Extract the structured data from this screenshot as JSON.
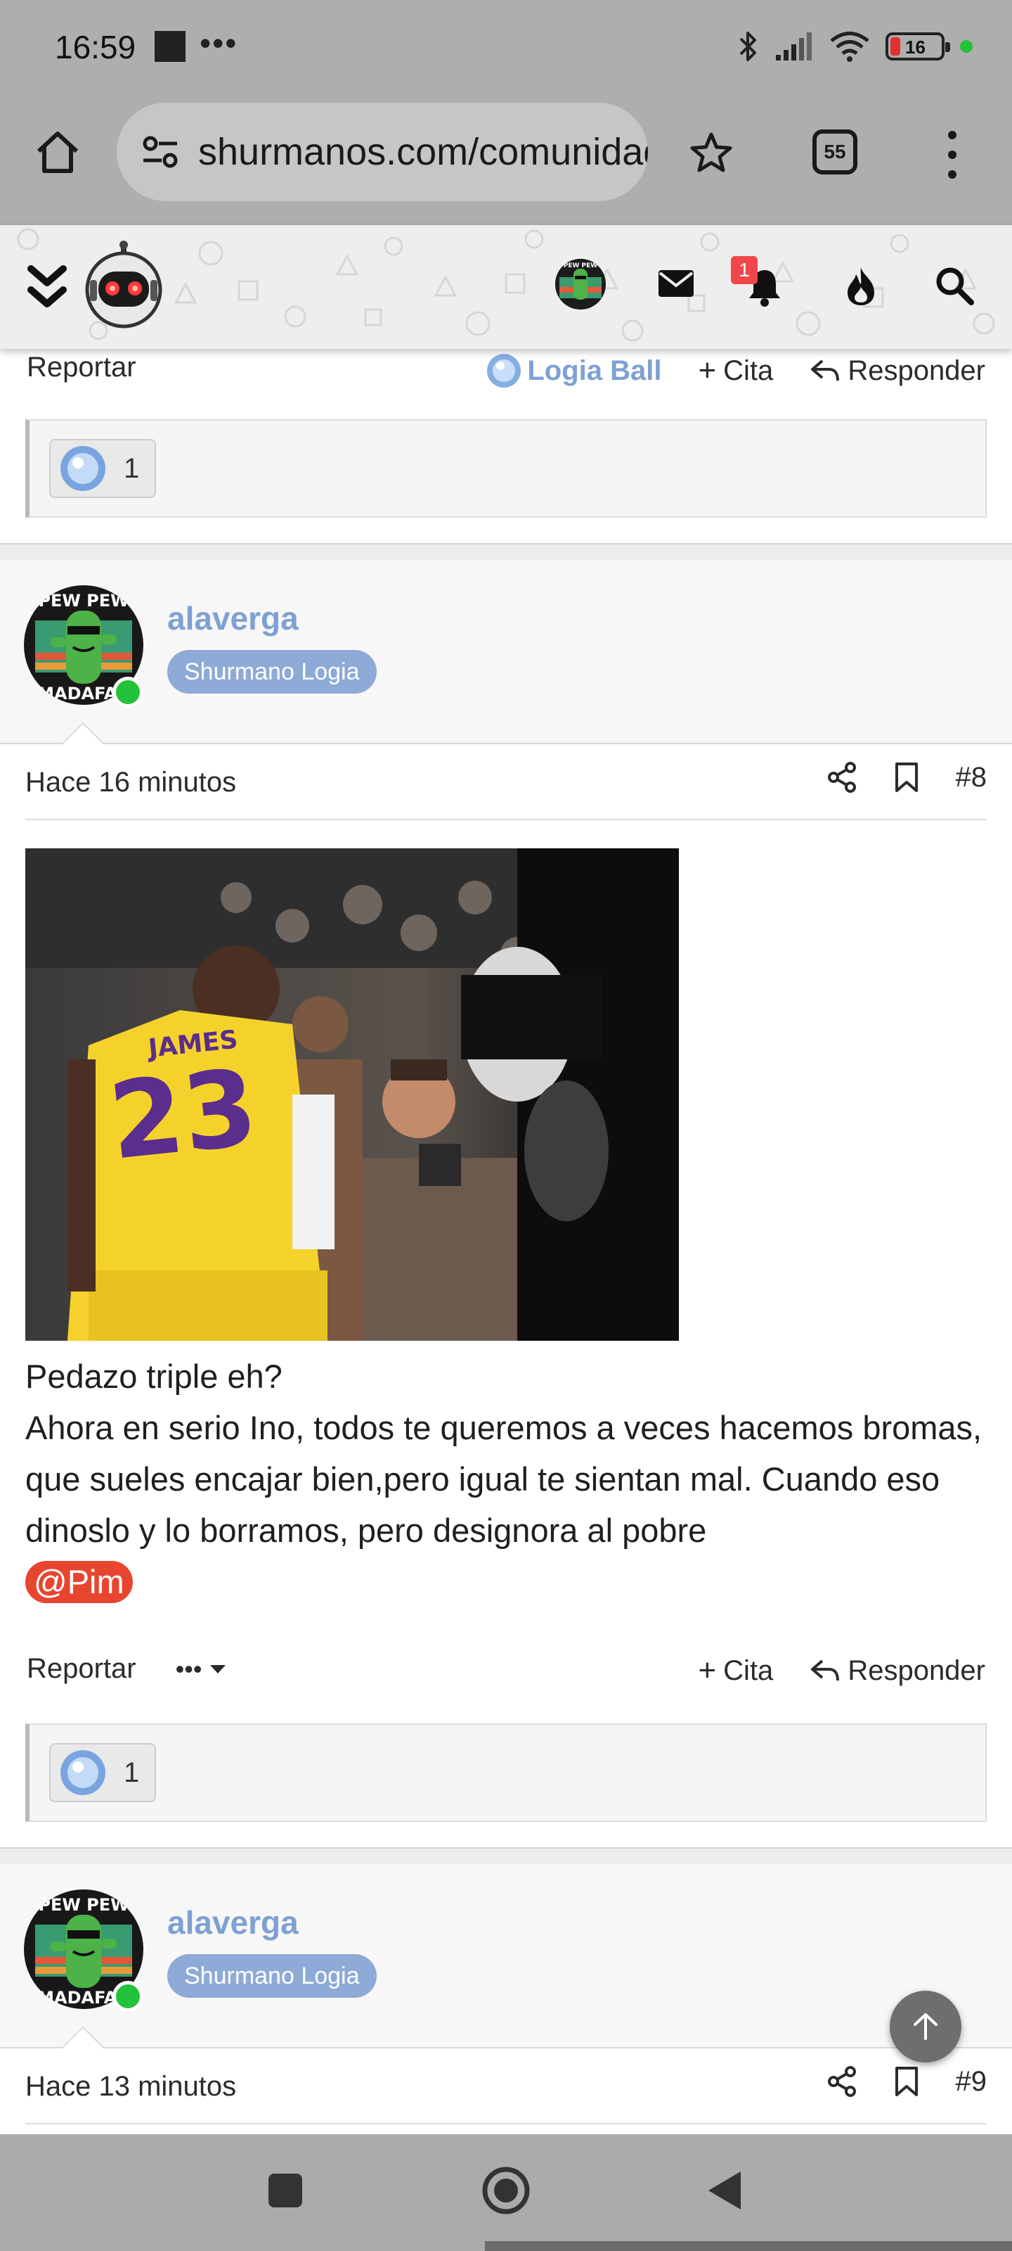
{
  "status_bar": {
    "time": "16:59",
    "dots": "•••",
    "battery_level": "16",
    "battery_color": "#e0312f",
    "indicator_color": "#24c23b"
  },
  "browser": {
    "url": "shurmanos.com/comunidad",
    "tab_count": "55",
    "icons": [
      "home-icon",
      "site-settings-icon",
      "bookmark-star-icon",
      "tabs-icon",
      "more-vert-icon"
    ]
  },
  "site_header": {
    "notification_count": "1",
    "icons": [
      "double-chevron-icon",
      "robot-logo",
      "user-avatar",
      "mail-icon",
      "bell-icon",
      "fire-icon",
      "search-icon"
    ],
    "accent": "#f0484a"
  },
  "prev_post": {
    "report_label": "Reportar",
    "reaction_label": "Logia Ball",
    "quote_label": "Cita",
    "reply_label": "Responder",
    "reaction_count": "1"
  },
  "posts": [
    {
      "username": "alaverga",
      "role": "Shurmano Logia",
      "avatar_text_top": "PEW PEW",
      "avatar_text_bottom": "MADAFAK",
      "time": "Hace 16 minutos",
      "post_number": "#8",
      "image_jersey_name": "JAMES",
      "image_jersey_number": "23",
      "body": [
        "Pedazo triple eh?",
        "Ahora en serio Ino, todos te queremos a veces hacemos bromas, que sueles encajar bien,pero igual te sientan mal. Cuando eso dinoslo y lo borramos, pero designora al pobre"
      ],
      "mention": "@Pim",
      "report_label": "Reportar",
      "more_label": "•••",
      "quote_label": "Cita",
      "reply_label": "Responder",
      "reaction_count": "1"
    },
    {
      "username": "alaverga",
      "role": "Shurmano Logia",
      "avatar_text_top": "PEW PEW",
      "avatar_text_bottom": "MADAFAK",
      "time": "Hace 13 minutos",
      "post_number": "#9"
    }
  ],
  "colors": {
    "username": "#7ea1d3",
    "role_badge": "#8eaad6",
    "mention": "#e8452f",
    "online": "#24c23b"
  }
}
